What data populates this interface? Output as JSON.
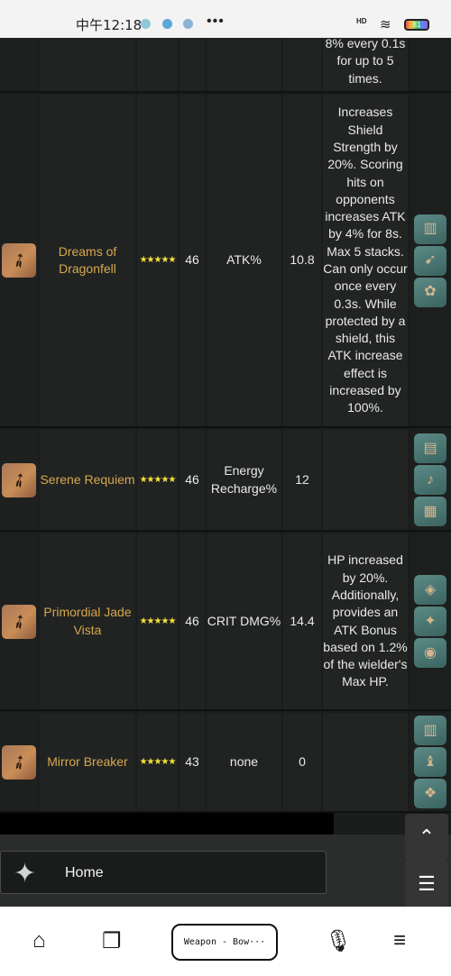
{
  "status_bar": {
    "time": "中午12:18",
    "more": "•••",
    "network": "HD",
    "battery": "81"
  },
  "table": {
    "rows": [
      {
        "id": "prev",
        "effect": "8% every 0.1s for up to 5 times."
      },
      {
        "id": "dreams",
        "name": "Dreams of Dragonfell",
        "rarity": 5,
        "stars": "★★★★★",
        "level": "46",
        "substat": "ATK%",
        "substat_value": "10.8",
        "effect": "Increases Shield Strength by 20%. Scoring hits on opponents increases ATK by 4% for 8s. Max 5 stacks. Can only occur once every 0.3s. While protected by a shield, this ATK increase effect is increased by 100%."
      },
      {
        "id": "serene",
        "name": "Serene Requiem",
        "rarity": 5,
        "stars": "★★★★★",
        "level": "46",
        "substat": "Energy Recharge%",
        "substat_value": "12",
        "effect": ""
      },
      {
        "id": "primordial",
        "name": "Primordial Jade Vista",
        "rarity": 5,
        "stars": "★★★★★",
        "level": "46",
        "substat": "CRIT DMG%",
        "substat_value": "14.4",
        "effect": "HP increased by 20%. Additionally, provides an ATK Bonus based on 1.2% of the wielder's Max HP."
      },
      {
        "id": "mirror",
        "name": "Mirror Breaker",
        "rarity": 5,
        "stars": "★★★★★",
        "level": "43",
        "substat": "none",
        "substat_value": "0",
        "effect": ""
      }
    ]
  },
  "side_menu": {
    "home_label": "Home"
  },
  "browser_nav": {
    "tab_label": "Weapon - Bow···"
  },
  "colors": {
    "weapon_name": "#d7a84d",
    "star": "#f5e23a",
    "cell_bg": "#212322"
  }
}
